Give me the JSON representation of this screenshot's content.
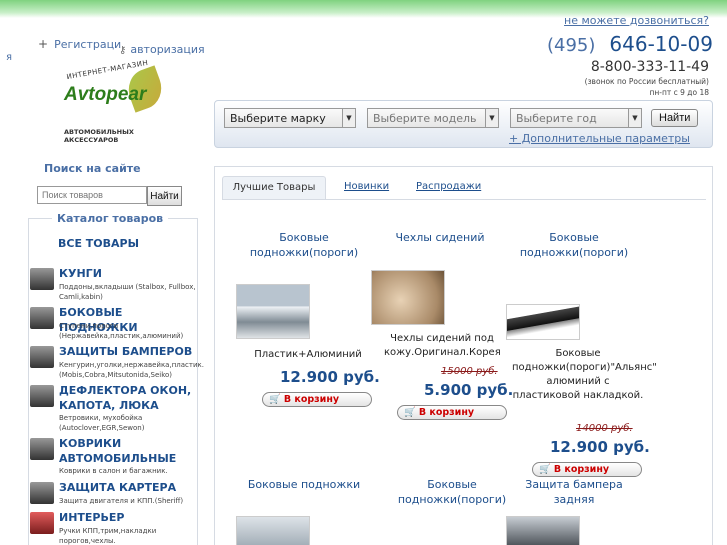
{
  "header": {
    "register_label": "Регистраци",
    "register_tail": "я",
    "auth_label": "авторизация",
    "call_link": "не можете дозвониться?",
    "phone_code": "(495)",
    "phone_number": "646-10-09",
    "phone_free": "8-800-333-11-49",
    "phone_free_note": "(звонок по России бесплатный)",
    "hours": "пн-пт с 9 до 18"
  },
  "logo": {
    "arc_text": "ИНТЕРНЕТ-МАГАЗИН",
    "name": "Avtopear",
    "subtitle": "АВТОМОБИЛЬНЫХ АКСЕССУАРОВ"
  },
  "filters": {
    "brand": "Выберите марку",
    "model": "Выберите модель",
    "year": "Выберите год",
    "find": "Найти",
    "more": "+ Дополнительные параметры"
  },
  "search": {
    "title": "Поиск на сайте",
    "placeholder": "Поиск товаров",
    "button": "Найти"
  },
  "catalog": {
    "title": "Каталог товаров",
    "all": "ВСЕ ТОВАРЫ",
    "items": [
      {
        "title": "КУНГИ",
        "desc": "Поддоны,вкладыши (Stalbox, Fullbox, Camli,kabin)"
      },
      {
        "title": "БОКОВЫЕ ПОДНОЖКИ",
        "desc": "Ступени,пороги (Нержавейка,пластик,алюминий)"
      },
      {
        "title": "ЗАЩИТЫ БАМПЕРОВ",
        "desc": "Кенгурин,уголки,нержавейка,пластик. (Mobis,Cobra,Mitsutonida,Seiko)"
      },
      {
        "title": "ДЕФЛЕКТОРА ОКОН, КАПОТА, ЛЮКА",
        "desc": "Ветровики, мухобойка (Autoclover,EGR,Sewon)"
      },
      {
        "title": "КОВРИКИ АВТОМОБИЛЬНЫЕ",
        "desc": "Коврики в салон и багажник."
      },
      {
        "title": "ЗАЩИТА КАРТЕРА",
        "desc": "Защита двигателя и КПП.(Sheriff)"
      },
      {
        "title": "ИНТЕРЬЕР",
        "desc": "Ручки КПП,трим,накладки порогов,чехлы."
      }
    ]
  },
  "tabs": [
    "Лучшие Товары",
    "Новинки",
    "Распродажи"
  ],
  "products": [
    {
      "title": "Боковые подножки(пороги)",
      "desc": "Пластик+Алюминий",
      "old_price": "",
      "price": "12.900 руб.",
      "cart": "В корзину"
    },
    {
      "title": "Чехлы сидений",
      "desc": "Чехлы сидений под кожу.Оригинал.Корея",
      "old_price": "15000 руб.",
      "price": "5.900 руб.",
      "cart": "В корзину"
    },
    {
      "title": "Боковые подножки(пороги)",
      "desc": "Боковые подножки(пороги)\"Альянс\" алюминий с пластиковой накладкой.",
      "old_price": "14000 руб.",
      "price": "12.900 руб.",
      "cart": "В корзину"
    },
    {
      "title": "Боковые подножки",
      "desc": "",
      "old_price": "",
      "price": "",
      "cart": ""
    },
    {
      "title": "Боковые подножки(пороги)",
      "desc": "",
      "old_price": "",
      "price": "",
      "cart": ""
    },
    {
      "title": "Защита бампера задняя",
      "desc": "",
      "old_price": "",
      "price": "",
      "cart": ""
    }
  ],
  "icons": {
    "plus": "plus-icon",
    "key": "key-icon",
    "cart": "cart-icon",
    "dropdown": "chevron-down-icon"
  }
}
